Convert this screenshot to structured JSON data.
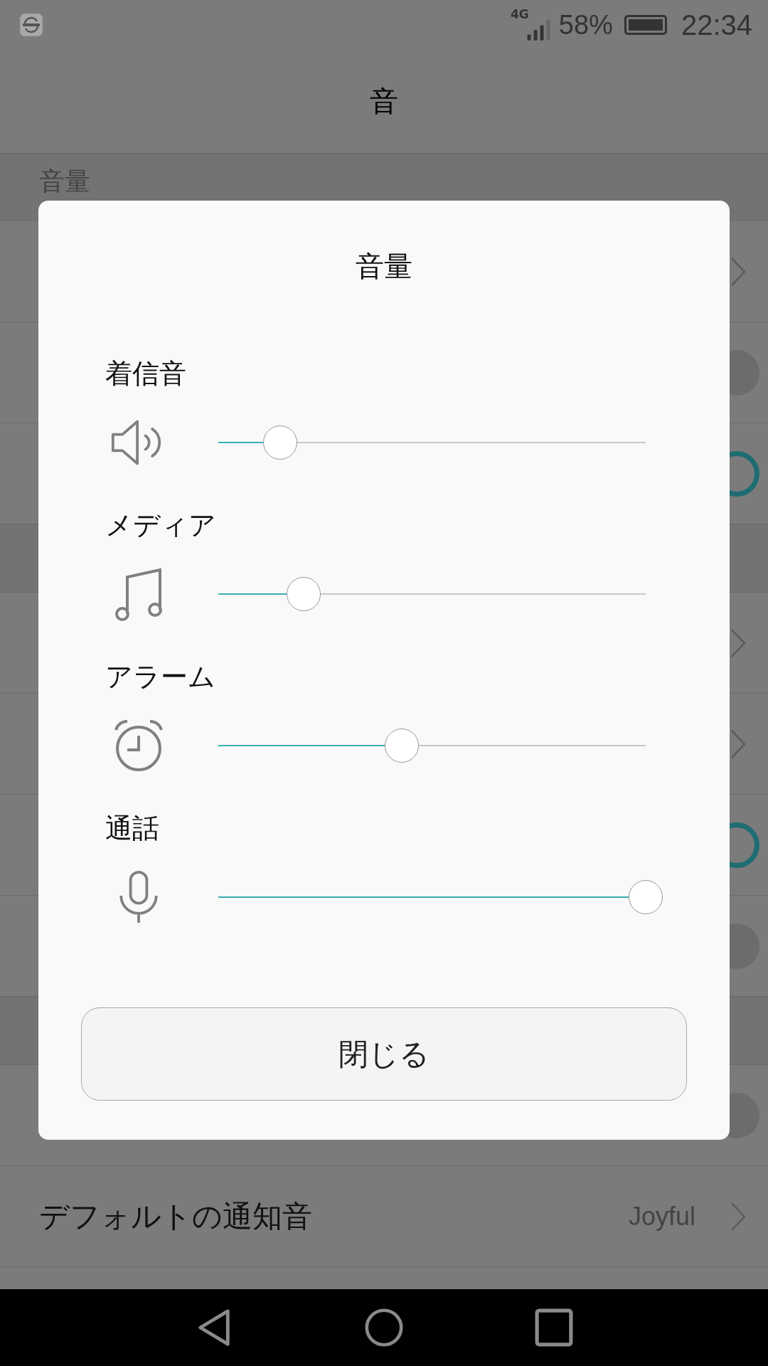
{
  "status_bar": {
    "network": "4G",
    "battery": "58%",
    "time": "22:34"
  },
  "header": {
    "title": "音"
  },
  "section": {
    "title": "音量"
  },
  "background_rows": [
    {
      "kind": "chevron"
    },
    {
      "kind": "toggle",
      "on": false
    },
    {
      "kind": "toggle",
      "on": true
    },
    {
      "kind": "section"
    },
    {
      "kind": "chevron"
    },
    {
      "kind": "chevron"
    },
    {
      "kind": "toggle",
      "on": true
    },
    {
      "kind": "toggle",
      "on": false
    },
    {
      "kind": "section"
    },
    {
      "kind": "toggle",
      "on": false
    },
    {
      "kind": "chevron",
      "label": "デフォルトの通知音",
      "value": "Joyful"
    }
  ],
  "dialog": {
    "title": "音量",
    "channels": [
      {
        "name": "着信音",
        "kind": "speaker",
        "level": 0.145
      },
      {
        "name": "メディア",
        "kind": "music",
        "level": 0.2
      },
      {
        "name": "アラーム",
        "kind": "alarm",
        "level": 0.43
      },
      {
        "name": "通話",
        "kind": "mic",
        "level": 1.0
      }
    ],
    "close_button": "閉じる"
  }
}
